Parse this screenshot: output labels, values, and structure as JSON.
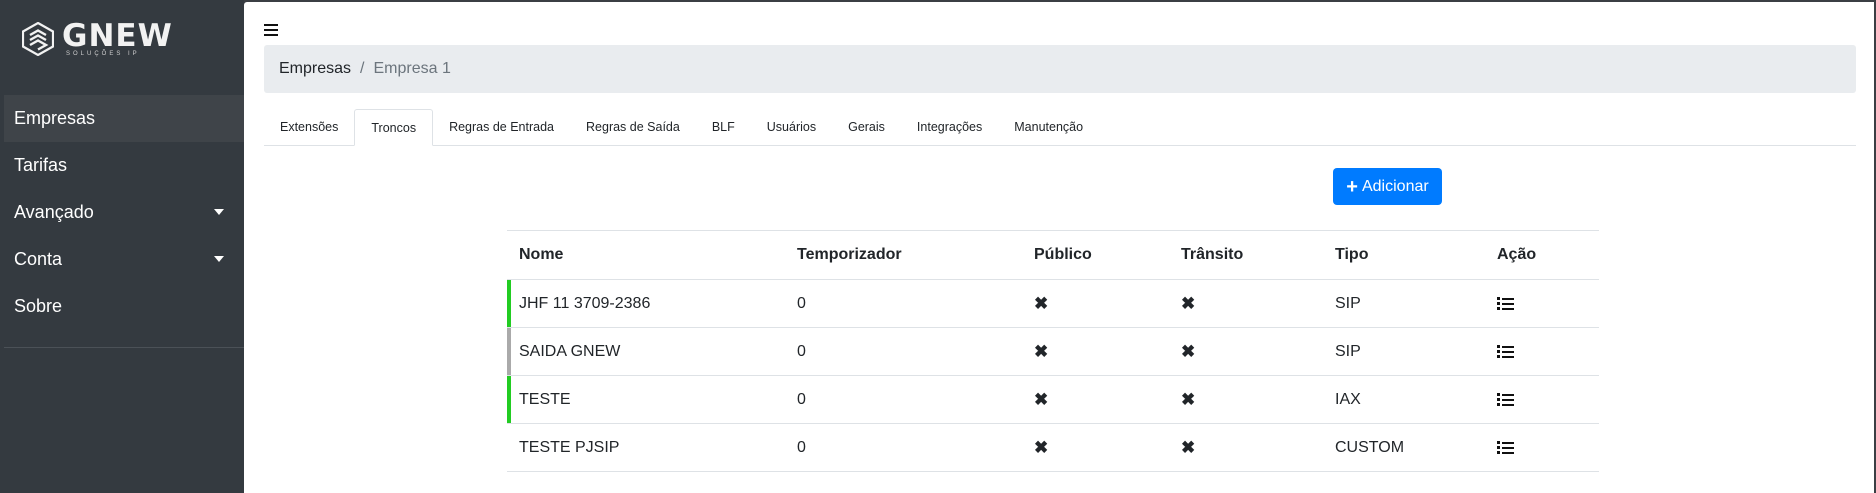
{
  "logo": {
    "name": "GNEW",
    "tagline": "SOLUÇÕES IP"
  },
  "sidebar": {
    "items": [
      {
        "label": "Empresas",
        "has_caret": false,
        "active": true
      },
      {
        "label": "Tarifas",
        "has_caret": false,
        "active": false
      },
      {
        "label": "Avançado",
        "has_caret": true,
        "active": false
      },
      {
        "label": "Conta",
        "has_caret": true,
        "active": false
      },
      {
        "label": "Sobre",
        "has_caret": false,
        "active": false
      }
    ]
  },
  "breadcrumb": {
    "parent": "Empresas",
    "separator": "/",
    "current": "Empresa 1"
  },
  "tabs": [
    "Extensões",
    "Troncos",
    "Regras de Entrada",
    "Regras de Saída",
    "BLF",
    "Usuários",
    "Gerais",
    "Integrações",
    "Manutenção"
  ],
  "active_tab": "Troncos",
  "add_button": {
    "label": "Adicionar",
    "icon": "plus-icon"
  },
  "table": {
    "headers": [
      "Nome",
      "Temporizador",
      "Público",
      "Trânsito",
      "Tipo",
      "Ação"
    ],
    "rows": [
      {
        "name": "JHF 11 3709-2386",
        "timer": "0",
        "public_icon": "x-icon",
        "transit_icon": "x-icon",
        "type": "SIP",
        "action_icon": "list-icon",
        "status_color": "#22cc22"
      },
      {
        "name": "SAIDA GNEW",
        "timer": "0",
        "public_icon": "x-icon",
        "transit_icon": "x-icon",
        "type": "SIP",
        "action_icon": "list-icon",
        "status_color": "#aaaaaa"
      },
      {
        "name": "TESTE",
        "timer": "0",
        "public_icon": "x-icon",
        "transit_icon": "x-icon",
        "type": "IAX",
        "action_icon": "list-icon",
        "status_color": "#22cc22"
      },
      {
        "name": "TESTE PJSIP",
        "timer": "0",
        "public_icon": "x-icon",
        "transit_icon": "x-icon",
        "type": "CUSTOM",
        "action_icon": "list-icon",
        "status_color": ""
      }
    ]
  },
  "colors": {
    "sidebar_bg": "#343a40",
    "primary": "#007bff",
    "breadcrumb_bg": "#e9ecef"
  }
}
